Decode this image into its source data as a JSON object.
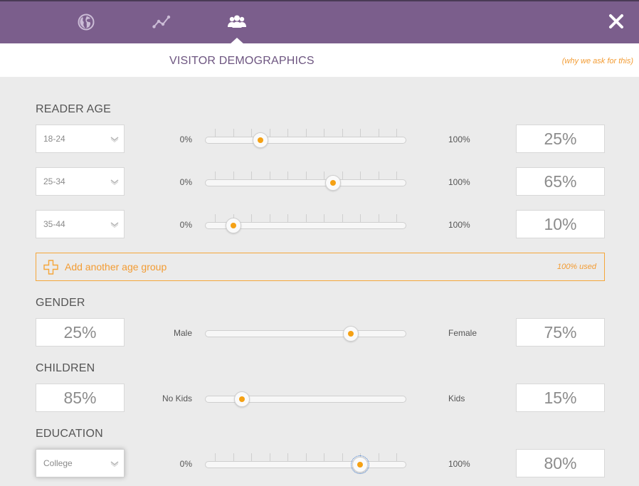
{
  "header": {
    "title": "VISITOR DEMOGRAPHICS",
    "why_link": "(why we ask for this)"
  },
  "tabs": [
    {
      "icon": "globe-icon",
      "active": false
    },
    {
      "icon": "line-chart-icon",
      "active": false
    },
    {
      "icon": "people-icon",
      "active": true
    }
  ],
  "reader_age": {
    "title": "READER AGE",
    "rows": [
      {
        "group": "18-24",
        "min_label": "0%",
        "max_label": "100%",
        "value_text": "25%",
        "value": 25
      },
      {
        "group": "25-34",
        "min_label": "0%",
        "max_label": "100%",
        "value_text": "65%",
        "value": 65
      },
      {
        "group": "35-44",
        "min_label": "0%",
        "max_label": "100%",
        "value_text": "10%",
        "value": 10
      }
    ],
    "add_label": "Add another age group",
    "used_label": "100% used"
  },
  "gender": {
    "title": "GENDER",
    "left_text": "25%",
    "left_label": "Male",
    "right_label": "Female",
    "right_text": "75%",
    "value": 75
  },
  "children": {
    "title": "CHILDREN",
    "left_text": "85%",
    "left_label": "No Kids",
    "right_label": "Kids",
    "right_text": "15%",
    "value": 15
  },
  "education": {
    "title": "EDUCATION",
    "level": "College",
    "min_label": "0%",
    "max_label": "100%",
    "value_text": "80%",
    "value": 80
  },
  "colors": {
    "purple_bar": "#7b5e8c",
    "accent_orange": "#f39c33",
    "title_purple": "#6d5580"
  }
}
